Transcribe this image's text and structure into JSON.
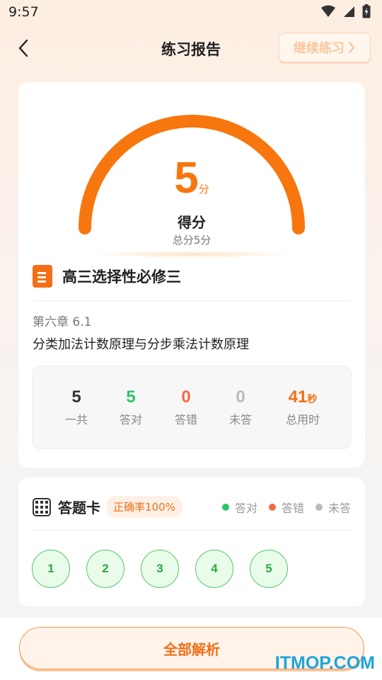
{
  "status_bar": {
    "time": "9:57"
  },
  "nav": {
    "title": "练习报告",
    "continue_label": "继续练习"
  },
  "score": {
    "value": "5",
    "unit": "分",
    "label": "得分",
    "total_text": "总分5分",
    "fraction": 1.0
  },
  "book": {
    "title": "高三选择性必修三"
  },
  "lesson": {
    "chapter": "第六章 6.1",
    "topic": "分类加法计数原理与分步乘法计数原理"
  },
  "stats": [
    {
      "value": "5",
      "unit": "",
      "label": "一共",
      "color": "#333333"
    },
    {
      "value": "5",
      "unit": "",
      "label": "答对",
      "color": "#2fc46a"
    },
    {
      "value": "0",
      "unit": "",
      "label": "答错",
      "color": "#f26a4a"
    },
    {
      "value": "0",
      "unit": "",
      "label": "未答",
      "color": "#bbbbbb"
    },
    {
      "value": "41",
      "unit": "秒",
      "label": "总用时",
      "color": "#f36f16"
    }
  ],
  "answer_card": {
    "title": "答题卡",
    "accuracy": "正确率100%",
    "legend": [
      {
        "label": "答对",
        "color": "#2fc46a"
      },
      {
        "label": "答错",
        "color": "#f26a4a"
      },
      {
        "label": "未答",
        "color": "#bbbbbb"
      }
    ],
    "questions": [
      "1",
      "2",
      "3",
      "4",
      "5"
    ]
  },
  "bottom": {
    "analyze_label": "全部解析"
  },
  "watermark": "ITMOP.COM",
  "colors": {
    "accent": "#f7760e",
    "correct": "#2fc46a",
    "wrong": "#f26a4a",
    "unanswered": "#bbbbbb"
  }
}
